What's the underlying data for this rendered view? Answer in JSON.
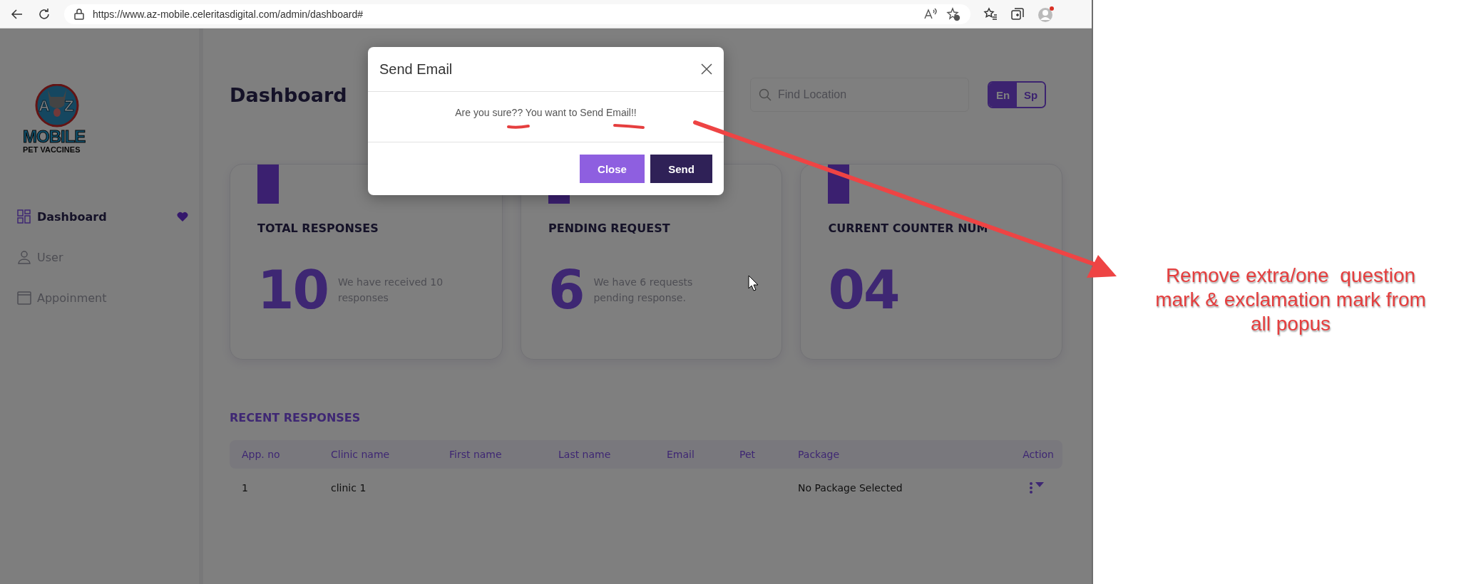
{
  "browser": {
    "url": "https://www.az-mobile.celeritasdigital.com/admin/dashboard#"
  },
  "sidebar": {
    "logo": {
      "letters": [
        "A",
        "Z"
      ],
      "name": "MOBILE",
      "tagline": "PET VACCINES"
    },
    "items": [
      {
        "label": "Dashboard",
        "kind": "grid",
        "selected": true
      },
      {
        "label": "User",
        "kind": "user",
        "selected": false
      },
      {
        "label": "Appoinment",
        "kind": "calendar",
        "selected": false
      }
    ]
  },
  "header": {
    "title": "Dashboard",
    "search": {
      "placeholder": "Find Location"
    },
    "languages": [
      {
        "label": "En",
        "selected": true
      },
      {
        "label": "Sp",
        "selected": false
      }
    ]
  },
  "cards": [
    {
      "title": "TOTAL RESPONSES",
      "value": "10",
      "description": "We have received 10 responses"
    },
    {
      "title": "PENDING REQUEST",
      "value": "6",
      "description": "We have 6 requests pending response."
    },
    {
      "title": "CURRENT COUNTER NUM",
      "value": "04"
    }
  ],
  "recent": {
    "title": "RECENT RESPONSES",
    "columns": [
      "App. no",
      "Clinic name",
      "First name",
      "Last name",
      "Email",
      "Pet",
      "Package",
      "Action"
    ],
    "rows": [
      {
        "app_no": "1",
        "clinic_name": "clinic 1",
        "package": "No Package Selected"
      }
    ]
  },
  "modal": {
    "title": "Send Email",
    "message": "Are you sure?? You want to Send Email!!",
    "buttons": [
      {
        "label": "Close",
        "kind": "secondary"
      },
      {
        "label": "Send",
        "kind": "primary"
      }
    ]
  },
  "annotation": {
    "lines": [
      "Remove extra/one  question",
      "mark & exclamation mark from",
      "all popus"
    ]
  }
}
